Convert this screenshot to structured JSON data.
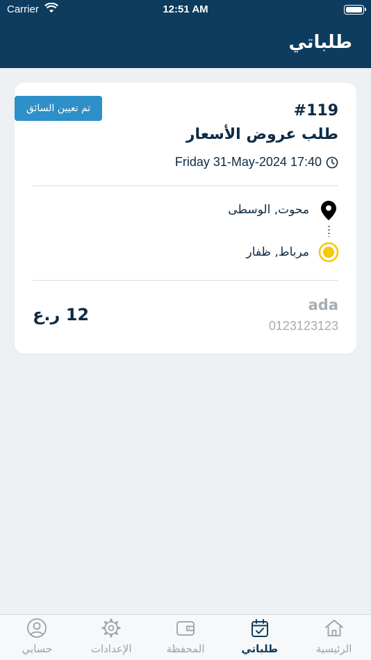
{
  "status_bar": {
    "carrier": "Carrier",
    "time": "12:51 AM"
  },
  "header": {
    "title": "طلباتي"
  },
  "order": {
    "status_badge": "تم تعيين السائق",
    "number": "#119",
    "type": "طلب عروض الأسعار",
    "datetime": "Friday 31-May-2024 17:40",
    "pickup": "محوت, الوسطى",
    "dropoff": "مرباط, ظفار",
    "customer_name": "ada",
    "customer_phone": "0123123123",
    "price": "12 ر.ع"
  },
  "tabs": [
    {
      "label": "حسابي",
      "icon": "user-circle-icon",
      "active": false
    },
    {
      "label": "الإعدادات",
      "icon": "gear-icon",
      "active": false
    },
    {
      "label": "المحفظة",
      "icon": "wallet-icon",
      "active": false
    },
    {
      "label": "طلباتي",
      "icon": "calendar-check-icon",
      "active": true
    },
    {
      "label": "الرئيسية",
      "icon": "home-icon",
      "active": false
    }
  ],
  "colors": {
    "header_bg": "#0d3c5e",
    "badge_bg": "#2f8fc9",
    "page_bg": "#eef1f4",
    "dropoff_yellow": "#f5c800"
  }
}
